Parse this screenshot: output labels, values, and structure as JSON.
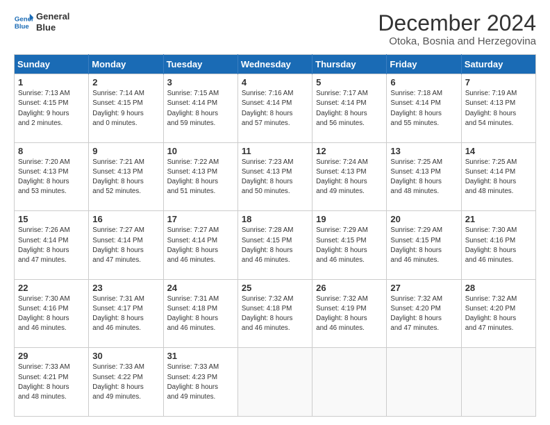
{
  "logo": {
    "line1": "General",
    "line2": "Blue"
  },
  "title": "December 2024",
  "subtitle": "Otoka, Bosnia and Herzegovina",
  "days_header": [
    "Sunday",
    "Monday",
    "Tuesday",
    "Wednesday",
    "Thursday",
    "Friday",
    "Saturday"
  ],
  "weeks": [
    [
      {
        "day": "1",
        "info": "Sunrise: 7:13 AM\nSunset: 4:15 PM\nDaylight: 9 hours\nand 2 minutes."
      },
      {
        "day": "2",
        "info": "Sunrise: 7:14 AM\nSunset: 4:15 PM\nDaylight: 9 hours\nand 0 minutes."
      },
      {
        "day": "3",
        "info": "Sunrise: 7:15 AM\nSunset: 4:14 PM\nDaylight: 8 hours\nand 59 minutes."
      },
      {
        "day": "4",
        "info": "Sunrise: 7:16 AM\nSunset: 4:14 PM\nDaylight: 8 hours\nand 57 minutes."
      },
      {
        "day": "5",
        "info": "Sunrise: 7:17 AM\nSunset: 4:14 PM\nDaylight: 8 hours\nand 56 minutes."
      },
      {
        "day": "6",
        "info": "Sunrise: 7:18 AM\nSunset: 4:14 PM\nDaylight: 8 hours\nand 55 minutes."
      },
      {
        "day": "7",
        "info": "Sunrise: 7:19 AM\nSunset: 4:13 PM\nDaylight: 8 hours\nand 54 minutes."
      }
    ],
    [
      {
        "day": "8",
        "info": "Sunrise: 7:20 AM\nSunset: 4:13 PM\nDaylight: 8 hours\nand 53 minutes."
      },
      {
        "day": "9",
        "info": "Sunrise: 7:21 AM\nSunset: 4:13 PM\nDaylight: 8 hours\nand 52 minutes."
      },
      {
        "day": "10",
        "info": "Sunrise: 7:22 AM\nSunset: 4:13 PM\nDaylight: 8 hours\nand 51 minutes."
      },
      {
        "day": "11",
        "info": "Sunrise: 7:23 AM\nSunset: 4:13 PM\nDaylight: 8 hours\nand 50 minutes."
      },
      {
        "day": "12",
        "info": "Sunrise: 7:24 AM\nSunset: 4:13 PM\nDaylight: 8 hours\nand 49 minutes."
      },
      {
        "day": "13",
        "info": "Sunrise: 7:25 AM\nSunset: 4:13 PM\nDaylight: 8 hours\nand 48 minutes."
      },
      {
        "day": "14",
        "info": "Sunrise: 7:25 AM\nSunset: 4:14 PM\nDaylight: 8 hours\nand 48 minutes."
      }
    ],
    [
      {
        "day": "15",
        "info": "Sunrise: 7:26 AM\nSunset: 4:14 PM\nDaylight: 8 hours\nand 47 minutes."
      },
      {
        "day": "16",
        "info": "Sunrise: 7:27 AM\nSunset: 4:14 PM\nDaylight: 8 hours\nand 47 minutes."
      },
      {
        "day": "17",
        "info": "Sunrise: 7:27 AM\nSunset: 4:14 PM\nDaylight: 8 hours\nand 46 minutes."
      },
      {
        "day": "18",
        "info": "Sunrise: 7:28 AM\nSunset: 4:15 PM\nDaylight: 8 hours\nand 46 minutes."
      },
      {
        "day": "19",
        "info": "Sunrise: 7:29 AM\nSunset: 4:15 PM\nDaylight: 8 hours\nand 46 minutes."
      },
      {
        "day": "20",
        "info": "Sunrise: 7:29 AM\nSunset: 4:15 PM\nDaylight: 8 hours\nand 46 minutes."
      },
      {
        "day": "21",
        "info": "Sunrise: 7:30 AM\nSunset: 4:16 PM\nDaylight: 8 hours\nand 46 minutes."
      }
    ],
    [
      {
        "day": "22",
        "info": "Sunrise: 7:30 AM\nSunset: 4:16 PM\nDaylight: 8 hours\nand 46 minutes."
      },
      {
        "day": "23",
        "info": "Sunrise: 7:31 AM\nSunset: 4:17 PM\nDaylight: 8 hours\nand 46 minutes."
      },
      {
        "day": "24",
        "info": "Sunrise: 7:31 AM\nSunset: 4:18 PM\nDaylight: 8 hours\nand 46 minutes."
      },
      {
        "day": "25",
        "info": "Sunrise: 7:32 AM\nSunset: 4:18 PM\nDaylight: 8 hours\nand 46 minutes."
      },
      {
        "day": "26",
        "info": "Sunrise: 7:32 AM\nSunset: 4:19 PM\nDaylight: 8 hours\nand 46 minutes."
      },
      {
        "day": "27",
        "info": "Sunrise: 7:32 AM\nSunset: 4:20 PM\nDaylight: 8 hours\nand 47 minutes."
      },
      {
        "day": "28",
        "info": "Sunrise: 7:32 AM\nSunset: 4:20 PM\nDaylight: 8 hours\nand 47 minutes."
      }
    ],
    [
      {
        "day": "29",
        "info": "Sunrise: 7:33 AM\nSunset: 4:21 PM\nDaylight: 8 hours\nand 48 minutes."
      },
      {
        "day": "30",
        "info": "Sunrise: 7:33 AM\nSunset: 4:22 PM\nDaylight: 8 hours\nand 49 minutes."
      },
      {
        "day": "31",
        "info": "Sunrise: 7:33 AM\nSunset: 4:23 PM\nDaylight: 8 hours\nand 49 minutes."
      },
      null,
      null,
      null,
      null
    ]
  ]
}
